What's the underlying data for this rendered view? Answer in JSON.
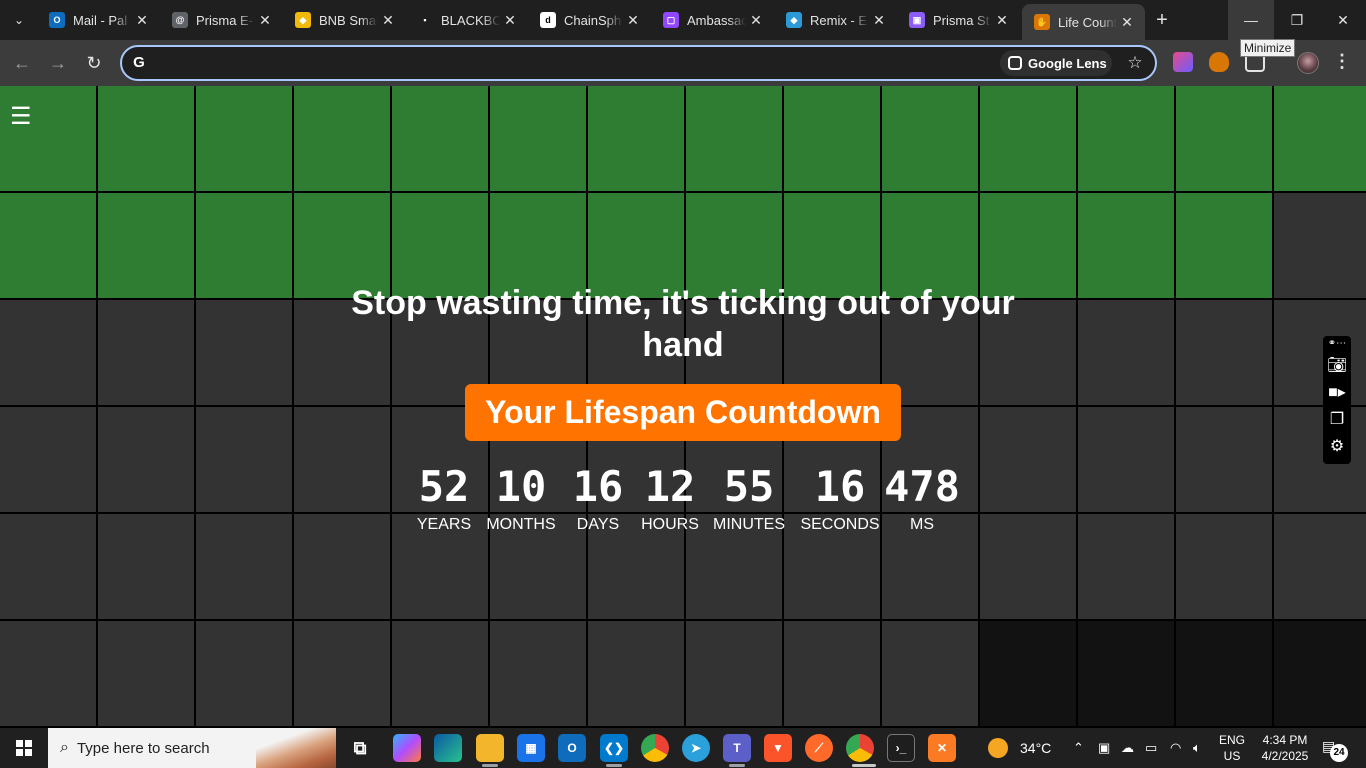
{
  "browser": {
    "tabs": [
      {
        "title": "Mail - Pal",
        "favicon_color": "#0f6cbd",
        "favicon": "O"
      },
      {
        "title": "Prisma E-",
        "favicon_color": "#5f6368",
        "favicon": "@"
      },
      {
        "title": "BNB Smar",
        "favicon_color": "#f0b90b",
        "favicon": "◆"
      },
      {
        "title": "BLACKBO",
        "favicon_color": "#1f1f1f",
        "favicon": "▪"
      },
      {
        "title": "ChainSph",
        "favicon_color": "#ffffff",
        "favicon": "d"
      },
      {
        "title": "Ambassac",
        "favicon_color": "#9146ff",
        "favicon": "▢"
      },
      {
        "title": "Remix - E",
        "favicon_color": "#2b9ad6",
        "favicon": "◆"
      },
      {
        "title": "Prisma St",
        "favicon_color": "#8b5cf6",
        "favicon": "▣"
      },
      {
        "title": "Life Count",
        "favicon_color": "#d97706",
        "favicon": "✋",
        "active": true
      }
    ],
    "tooltip": "Minimize",
    "omnibox": {
      "value": "",
      "lens_label": "Google Lens"
    },
    "colors": {
      "omnibox_focus": "#a8c7fa",
      "toolbar": "#3c3c3c",
      "tabstrip": "#1f1f1f"
    }
  },
  "page": {
    "menu_icon": "hamburger-icon",
    "headline": "Stop wasting time, it's ticking out of your hand",
    "cta_label": "Your Lifespan Countdown",
    "countdown": [
      {
        "value": "52",
        "label": "YEARS"
      },
      {
        "value": "10",
        "label": "MONTHS"
      },
      {
        "value": "16",
        "label": "DAYS"
      },
      {
        "value": "12",
        "label": "HOURS"
      },
      {
        "value": "55",
        "label": "MINUTES"
      },
      {
        "value": "16",
        "label": "SECONDS"
      },
      {
        "value": "478",
        "label": "MS"
      }
    ],
    "grid": {
      "total_cells": 84,
      "lived_cells": 27,
      "empty_cells": 4
    },
    "colors": {
      "lived": "#2e7d32",
      "remaining": "#333333",
      "cta": "#ff7300"
    },
    "side_tools": [
      "link-icon",
      "camera-icon",
      "video-icon",
      "window-icon",
      "gear-icon"
    ]
  },
  "taskbar": {
    "search_placeholder": "Type here to search",
    "weather": "34°C",
    "language": {
      "line1": "ENG",
      "line2": "US"
    },
    "clock": {
      "time": "4:34 PM",
      "date": "4/2/2025"
    },
    "notification_count": "24"
  }
}
